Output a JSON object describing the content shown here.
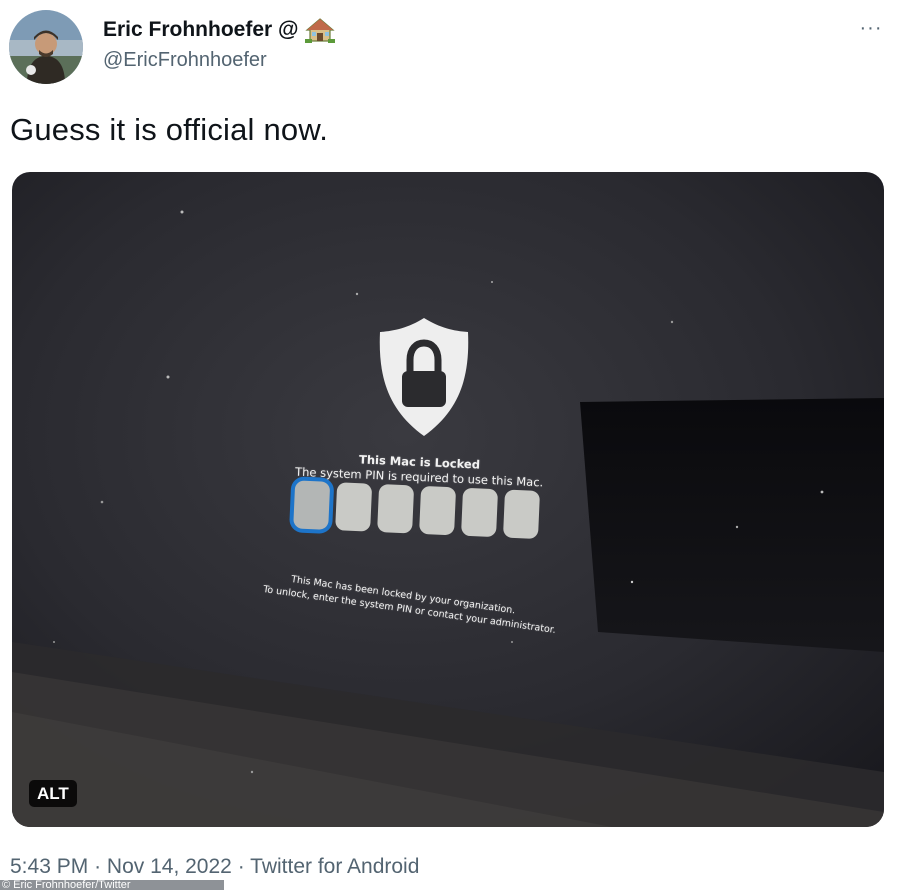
{
  "author": {
    "display_name": "Eric Frohnhoefer @",
    "handle": "@EricFrohnhoefer",
    "avatar_icon": "avatar-photo",
    "name_icon": "house-icon"
  },
  "more_icon": "more-options-icon",
  "more_label": "···",
  "tweet": {
    "text": "Guess it is official now."
  },
  "media": {
    "alt_badge": "ALT",
    "screen": {
      "title": "This Mac is Locked",
      "subtitle": "The system PIN is required to use this Mac.",
      "pin_box_count": 6,
      "note_line1": "This Mac has been locked by your organization.",
      "note_line2": "To unlock, enter the system PIN or contact your administrator.",
      "lock_icon": "shield-lock-icon"
    }
  },
  "meta": {
    "time": "5:43 PM",
    "separator": "·",
    "date": "Nov 14, 2022",
    "source": "Twitter for Android"
  },
  "credit": "© Eric Frohnhoefer/Twitter",
  "colors": {
    "text_primary": "#0f1419",
    "text_secondary": "#536471",
    "pin_focus": "#1d74c9"
  }
}
